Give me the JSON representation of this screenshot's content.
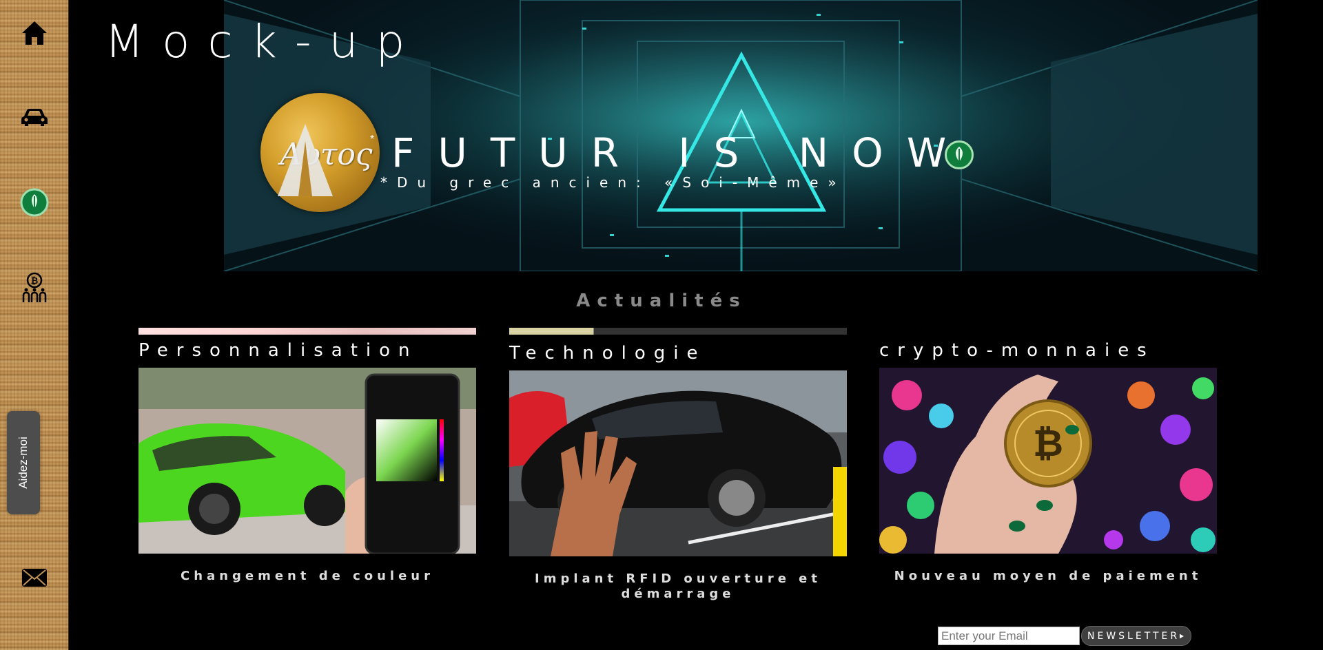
{
  "header": {
    "title": "Mock-up"
  },
  "sidebar": {
    "items": [
      {
        "icon": "home-icon",
        "label": ""
      },
      {
        "icon": "car-icon",
        "label": ""
      },
      {
        "icon": "leaf-badge-icon",
        "label": ""
      },
      {
        "icon": "bitcoin-people-icon",
        "label": ""
      },
      {
        "icon": "mail-icon",
        "label": ""
      }
    ],
    "help_label": "Aidez-moi"
  },
  "banner": {
    "logo_text": "Αυτος",
    "logo_star": "*",
    "slogan": "FUTUR IS NOW",
    "subtitle": "*Du grec ancien: «Soi-Même»"
  },
  "news": {
    "section_title": "Actualités",
    "cards": [
      {
        "title": "Personnalisation",
        "caption": "Changement de couleur"
      },
      {
        "title": "Technologie",
        "caption": "Implant RFID ouverture et démarrage"
      },
      {
        "title": "crypto-monnaies",
        "caption": "Nouveau moyen de paiement"
      }
    ]
  },
  "newsletter": {
    "placeholder": "Enter your Email",
    "button_label": "NEWSLETTER"
  },
  "colors": {
    "accent_green": "#0f7d3c",
    "banner_cyan": "#35e8e6",
    "gold": "#d39d2a"
  }
}
